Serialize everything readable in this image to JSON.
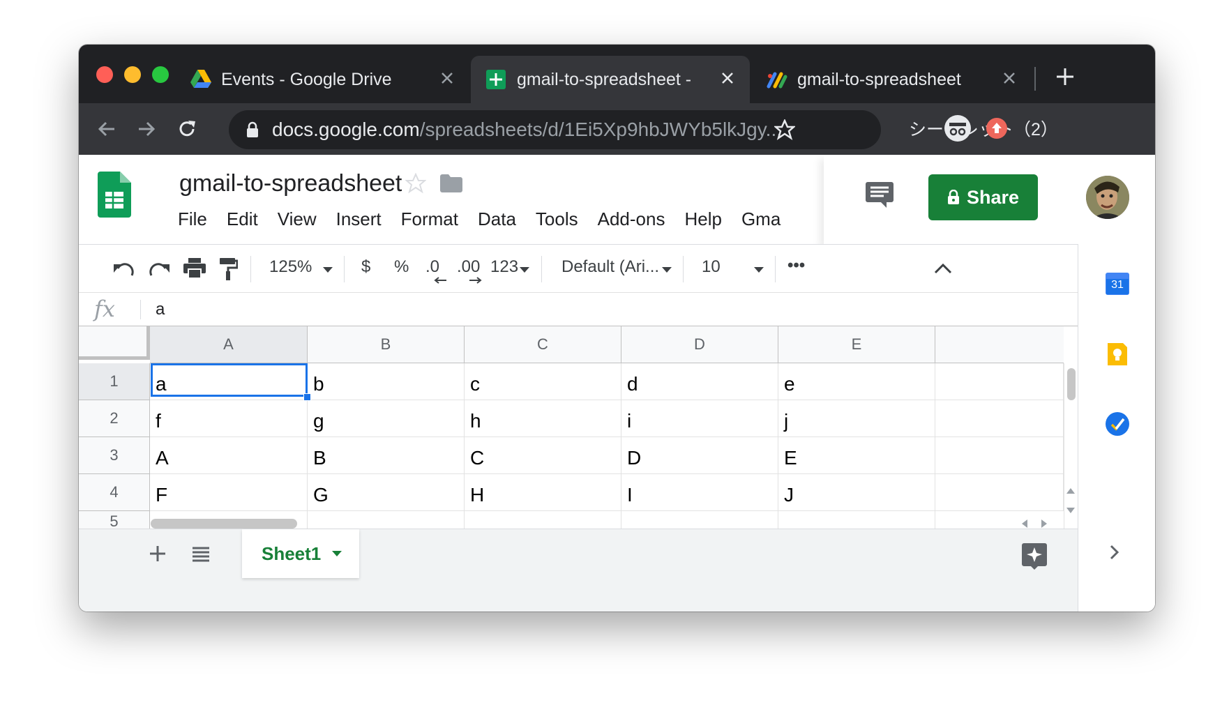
{
  "browser": {
    "tabs": [
      {
        "title": "Events - Google Drive",
        "icon": "google-drive-icon"
      },
      {
        "title": "gmail-to-spreadsheet - ",
        "icon": "google-sheets-icon",
        "active": true
      },
      {
        "title": "gmail-to-spreadsheet",
        "icon": "apps-script-icon"
      }
    ],
    "url_host": "docs.google.com",
    "url_path": "/spreadsheets/d/1Ei5Xp9hbJWYb5lkJgy...",
    "incognito_label": "シークレット（2）"
  },
  "sheets": {
    "doc_title": "gmail-to-spreadsheet",
    "menu": [
      "File",
      "Edit",
      "View",
      "Insert",
      "Format",
      "Data",
      "Tools",
      "Add-ons",
      "Help",
      "Gma"
    ],
    "share_label": "Share",
    "toolbar": {
      "zoom": "125%",
      "currency": "$",
      "percent": "%",
      "decrease_decimal": ".0",
      "increase_decimal": ".00",
      "more_formats": "123",
      "font": "Default (Ari...",
      "font_size": "10",
      "more": "•••"
    },
    "formula_bar": {
      "fx": "fx",
      "value": "a"
    },
    "columns": [
      "A",
      "B",
      "C",
      "D",
      "E"
    ],
    "rows": [
      {
        "num": "1",
        "cells": [
          "a",
          "b",
          "c",
          "d",
          "e"
        ]
      },
      {
        "num": "2",
        "cells": [
          "f",
          "g",
          "h",
          "i",
          "j"
        ]
      },
      {
        "num": "3",
        "cells": [
          "A",
          "B",
          "C",
          "D",
          "E"
        ]
      },
      {
        "num": "4",
        "cells": [
          "F",
          "G",
          "H",
          "I",
          "J"
        ]
      },
      {
        "num": "5",
        "cells": [
          "",
          "",
          "",
          "",
          ""
        ]
      }
    ],
    "sheet_tab": "Sheet1",
    "side_panel": {
      "calendar_day": "31"
    },
    "colors": {
      "green": "#188038",
      "blue": "#1a73e8",
      "chrome_dark": "#202124",
      "chrome_mid": "#35363a"
    }
  }
}
